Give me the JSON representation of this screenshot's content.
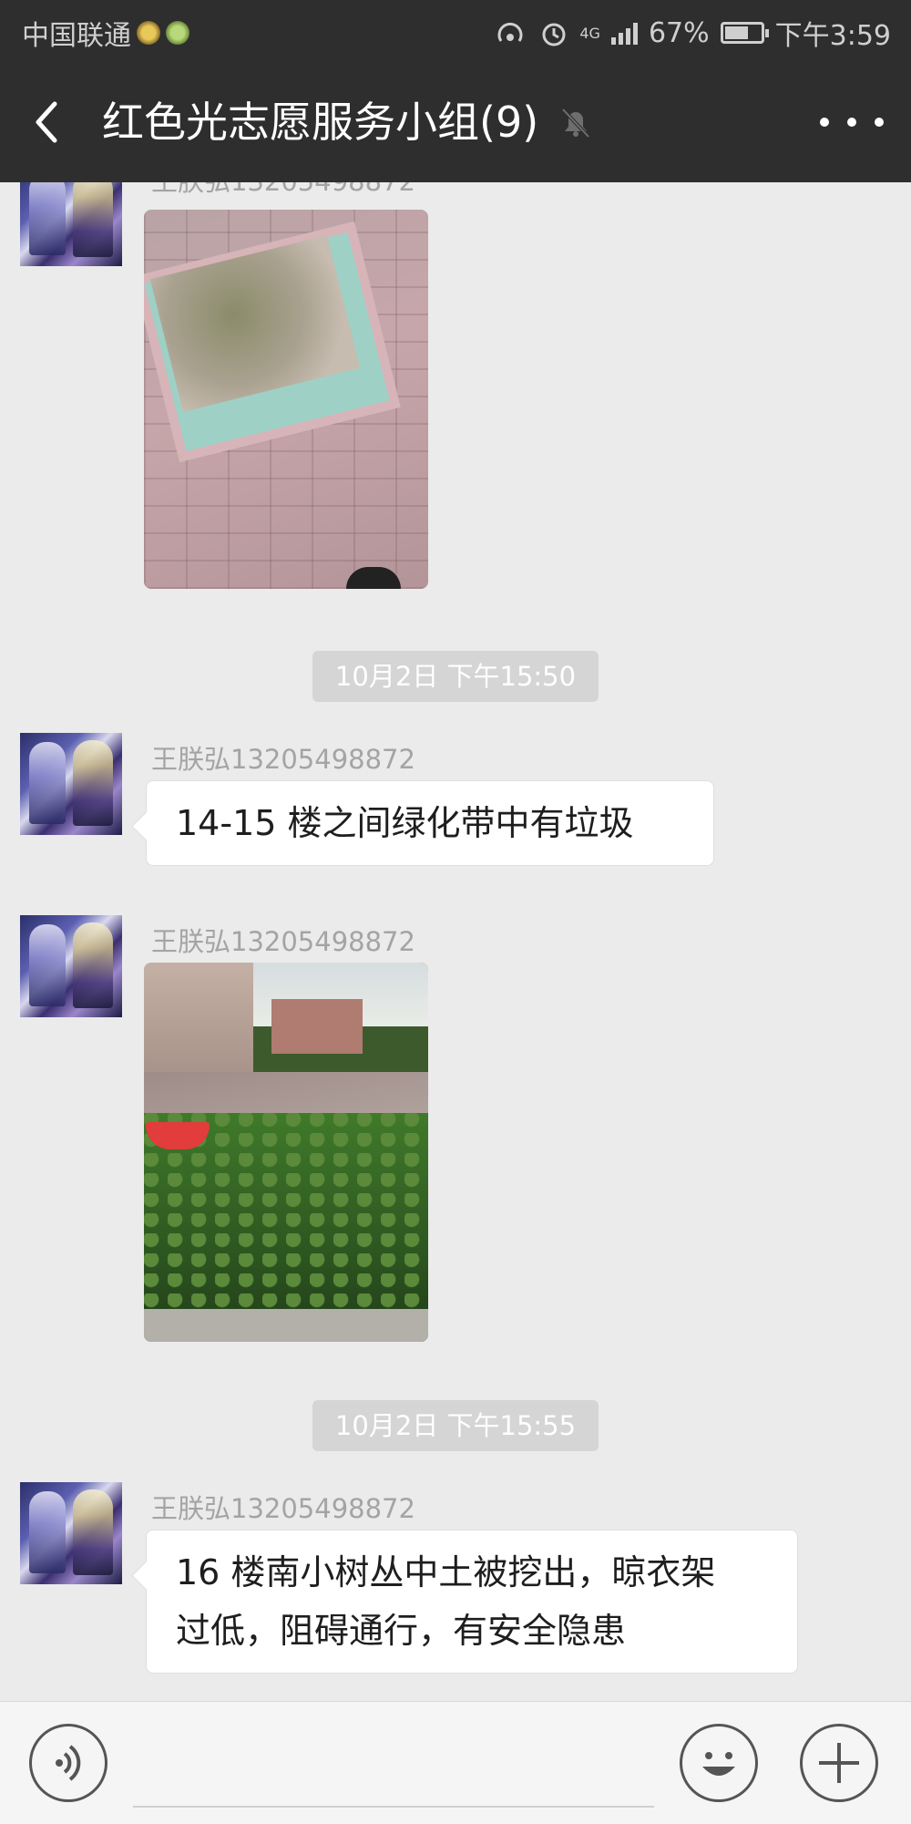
{
  "status_bar": {
    "carrier": "中国联通",
    "network": "4G",
    "battery": "67%",
    "time": "下午3:59",
    "battery_level": 0.67
  },
  "header": {
    "title": "红色光志愿服务小组(9)"
  },
  "messages": [
    {
      "sender": "王朕弘13205498872",
      "type": "image"
    },
    {
      "timestamp": "10月2日 下午15:50"
    },
    {
      "sender": "王朕弘13205498872",
      "type": "text",
      "text": "14-15 楼之间绿化带中有垃圾"
    },
    {
      "sender": "王朕弘13205498872",
      "type": "image"
    },
    {
      "timestamp": "10月2日 下午15:55"
    },
    {
      "sender": "王朕弘13205498872",
      "type": "text",
      "lines": [
        "16 楼南小树丛中土被挖出，晾衣架",
        "过低，阻碍通行，有安全隐患"
      ]
    }
  ],
  "colors": {
    "header_bg": "#2e2e2e",
    "chat_bg": "#ebebeb",
    "bubble_bg": "#ffffff",
    "timestamp_bg": "#d5d5d5"
  }
}
